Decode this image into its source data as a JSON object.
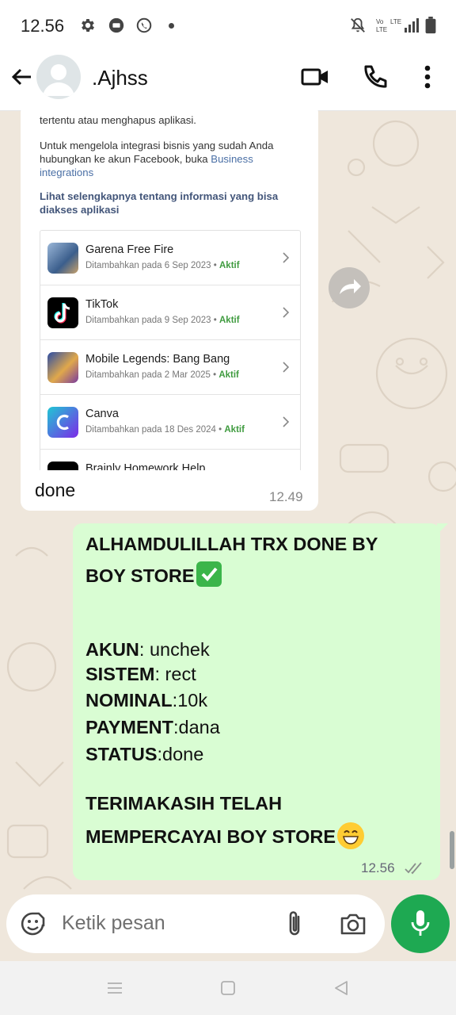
{
  "status_bar": {
    "time": "12.56",
    "icons": [
      "gear-icon",
      "chat-bubble-icon",
      "whatsapp-icon",
      "dot-icon",
      "mute-icon",
      "volte-icon",
      "lte-signal-icon",
      "battery-icon"
    ]
  },
  "header": {
    "contact_name": ".Ajhss",
    "icons": [
      "back-arrow-icon",
      "avatar",
      "video-call-icon",
      "phone-icon",
      "more-vert-icon"
    ]
  },
  "incoming": {
    "screenshot": {
      "intro_text": "tertentu atau menghapus aplikasi.",
      "manage_text": "Untuk mengelola integrasi bisnis yang sudah Anda hubungkan ke akun Facebook, buka",
      "manage_link": "Business integrations",
      "see_more": "Lihat selengkapnya tentang informasi yang bisa diakses aplikasi",
      "apps": [
        {
          "name": "Garena Free Fire",
          "added": "Ditambahkan pada 6 Sep 2023",
          "status": "Aktif"
        },
        {
          "name": "TikTok",
          "added": "Ditambahkan pada 9 Sep 2023",
          "status": "Aktif"
        },
        {
          "name": "Mobile Legends: Bang Bang",
          "added": "Ditambahkan pada 2 Mar 2025",
          "status": "Aktif"
        },
        {
          "name": "Canva",
          "added": "Ditambahkan pada 18 Des 2024",
          "status": "Aktif"
        },
        {
          "name": "Brainly Homework Help",
          "added": "",
          "status": ""
        }
      ]
    },
    "text": "done",
    "time": "12.49"
  },
  "outgoing": {
    "title_line1": "ALHAMDULILLAH TRX DONE BY",
    "title_line2": "BOY STORE",
    "fields": [
      {
        "label": "AKUN",
        "sep": ": ",
        "value": "unchek"
      },
      {
        "label": "SISTEM",
        "sep": ": ",
        "value": "rect"
      },
      {
        "label": "NOMINAL",
        "sep": ":",
        "value": "10k"
      },
      {
        "label": "PAYMENT",
        "sep": ":",
        "value": "dana"
      },
      {
        "label": "STATUS",
        "sep": ":",
        "value": "done"
      }
    ],
    "thanks_line1": "TERIMAKASIH TELAH",
    "thanks_line2": "MEMPERCAYAI BOY STORE",
    "time": "12.56"
  },
  "composer": {
    "placeholder": "Ketik pesan"
  },
  "colors": {
    "outgoing_bubble": "#d9fdd3",
    "accent_green": "#1ea952",
    "wallpaper": "#efe7dc",
    "active_green": "#3f9b3f"
  }
}
